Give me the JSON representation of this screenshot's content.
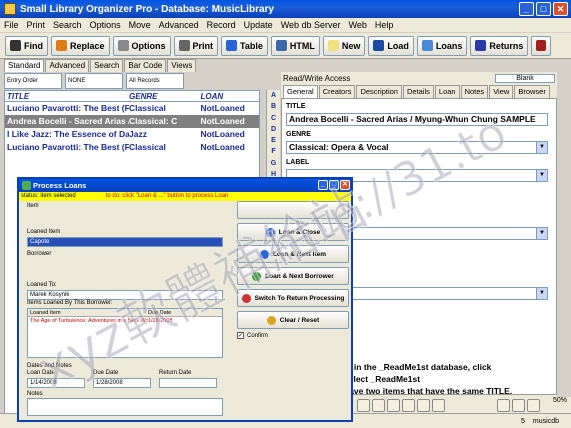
{
  "window": {
    "title": "Small Library Organizer Pro - Database: MusicLibrary",
    "min": "_",
    "max": "□",
    "close": "✕"
  },
  "menu": [
    "File",
    "Print",
    "Search",
    "Options",
    "Move",
    "Advanced",
    "Record",
    "Update",
    "Web db Server",
    "Web",
    "Help"
  ],
  "toolbar": [
    "Find",
    "Replace",
    "Options",
    "Print",
    "Table",
    "HTML",
    "New",
    "Load",
    "Loans",
    "Returns"
  ],
  "toolbar_icons": [
    "binoculars-icon",
    "replace-icon",
    "options-icon",
    "printer-icon",
    "table-icon",
    "html-icon",
    "new-icon",
    "load-icon",
    "loans-icon",
    "returns-icon"
  ],
  "left_tabs": [
    "Standard",
    "Advanced",
    "Search",
    "Bar Code",
    "Views"
  ],
  "filters": [
    "Entry Order",
    "NONE",
    "All Records"
  ],
  "grid": {
    "headers": [
      "TITLE",
      "GENRE",
      "LOAN"
    ],
    "rows": [
      [
        "Luciano Pavarotti: The Best (Farew",
        "Classical",
        "NotLoaned"
      ],
      [
        "Andrea Bocelli - Sacred Arias / Myu",
        "Classical: C",
        "NotLoaned"
      ],
      [
        "I Like Jazz: The Essence of Dave Br",
        "Jazz",
        "NotLoaned"
      ],
      [
        "Luciano Pavarotti: The Best (Farew",
        "Classical",
        "NotLoaned"
      ]
    ],
    "selected_index": 1
  },
  "alphabet": [
    "A",
    "B",
    "C",
    "D",
    "E",
    "F",
    "G",
    "H",
    "I",
    "J",
    "K",
    "L",
    "M",
    "N",
    "O",
    "P",
    "Q",
    "R",
    "S",
    "T",
    "U",
    "V",
    "W",
    "X",
    "Y",
    "Z"
  ],
  "right": {
    "access": "Read/Write Access",
    "blank": "Blank",
    "tabs": [
      "General",
      "Creators",
      "Description",
      "Details",
      "Loan",
      "Notes",
      "View",
      "Browser"
    ],
    "title_label": "TITLE",
    "title_value": "Andrea Bocelli - Sacred Arias / Myung-Whun Chung   SAMPLE",
    "genre_label": "GENRE",
    "genre_value": "Classical: Opera & Vocal",
    "label_label": "LABEL",
    "partial_value": "D",
    "notes": "ts in the _ReadMe1st database, click\nselect _ReadMe1st\nhave two items that have the same  TITLE."
  },
  "status": {
    "left": "5",
    "right": "musicdb",
    "zoom": "50%"
  },
  "dialog": {
    "title": "Process Loans",
    "status_msg": "status: item selected",
    "status_hint": "to do: click \"Loan & ...\" button to process Loan",
    "item_label": "Item",
    "loaned_item_label": "Loaned Item",
    "loaned_item_value": "Capote",
    "borrower_label": "Borrower",
    "loaned_to_label": "Loaned To:",
    "loaned_to_value": "Marek Kosynik",
    "items_loaned_label": "Items Loaned By This Borrower:",
    "items_header": [
      "Loaned Item",
      "Due Date"
    ],
    "items_rows": [
      [
        "The Age of Turbulence: Adventures in a New World",
        "1/28/2008"
      ]
    ],
    "dates_label": "Dates and Notes",
    "loan_date_label": "Loan Date",
    "loan_date": "1/14/2008",
    "due_date_label": "Due Date",
    "due_date": "1/28/2008",
    "return_date_label": "Return Date",
    "notes_label": "Notes",
    "buttons": [
      "Loan & Close",
      "Loan & Next Item",
      "Loan & Next Borrower",
      "Switch To Return Processing",
      "Clear / Reset"
    ],
    "button_icon_colors": [
      "#2a63d8",
      "#2a63d8",
      "#2e9a2e",
      "#d03030",
      "#d9a520"
    ],
    "confirm_label": "Confirm"
  },
  "watermark": {
    "text_cn": "xyz軟體補給站",
    "text_url": "http://31.to"
  }
}
